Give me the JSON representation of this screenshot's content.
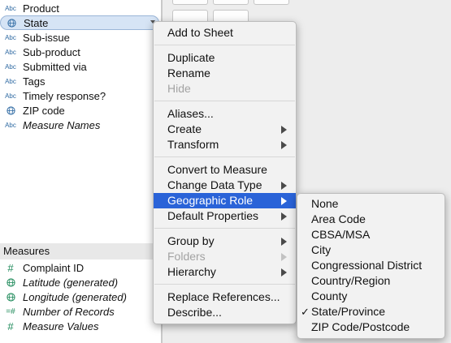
{
  "dimensions": {
    "items": [
      {
        "label": "Product",
        "icon": "abc-icon",
        "type": "abc",
        "italic": false
      },
      {
        "label": "State",
        "icon": "globe-icon",
        "type": "geo",
        "italic": false,
        "selected": true
      },
      {
        "label": "Sub-issue",
        "icon": "abc-icon",
        "type": "abc",
        "italic": false
      },
      {
        "label": "Sub-product",
        "icon": "abc-icon",
        "type": "abc",
        "italic": false
      },
      {
        "label": "Submitted via",
        "icon": "abc-icon",
        "type": "abc",
        "italic": false
      },
      {
        "label": "Tags",
        "icon": "abc-icon",
        "type": "abc",
        "italic": false
      },
      {
        "label": "Timely response?",
        "icon": "abc-icon",
        "type": "abc",
        "italic": false
      },
      {
        "label": "ZIP code",
        "icon": "globe-icon",
        "type": "geo",
        "italic": false
      },
      {
        "label": "Measure Names",
        "icon": "abc-icon",
        "type": "abc",
        "italic": true
      }
    ],
    "abc_text": "Abc"
  },
  "measures": {
    "header": "Measures",
    "items": [
      {
        "label": "Complaint ID",
        "icon": "hash-icon",
        "type": "num",
        "italic": false
      },
      {
        "label": "Latitude (generated)",
        "icon": "globe-icon",
        "type": "geo",
        "italic": true
      },
      {
        "label": "Longitude (generated)",
        "icon": "globe-icon",
        "type": "geo",
        "italic": true
      },
      {
        "label": "Number of Records",
        "icon": "hash-icon",
        "type": "calc",
        "italic": true
      },
      {
        "label": "Measure Values",
        "icon": "hash-icon",
        "type": "num",
        "italic": true
      }
    ],
    "hash_text": "#",
    "calc_text": "=#"
  },
  "context_menu": {
    "items": [
      {
        "label": "Add to Sheet",
        "submenu": false,
        "disabled": false
      },
      {
        "label": "Duplicate",
        "submenu": false,
        "disabled": false
      },
      {
        "label": "Rename",
        "submenu": false,
        "disabled": false
      },
      {
        "label": "Hide",
        "submenu": false,
        "disabled": true
      },
      {
        "label": "Aliases...",
        "submenu": false,
        "disabled": false
      },
      {
        "label": "Create",
        "submenu": true,
        "disabled": false
      },
      {
        "label": "Transform",
        "submenu": true,
        "disabled": false
      },
      {
        "label": "Convert to Measure",
        "submenu": false,
        "disabled": false
      },
      {
        "label": "Change Data Type",
        "submenu": true,
        "disabled": false
      },
      {
        "label": "Geographic Role",
        "submenu": true,
        "disabled": false,
        "highlighted": true
      },
      {
        "label": "Default Properties",
        "submenu": true,
        "disabled": false
      },
      {
        "label": "Group by",
        "submenu": true,
        "disabled": false
      },
      {
        "label": "Folders",
        "submenu": true,
        "disabled": true
      },
      {
        "label": "Hierarchy",
        "submenu": true,
        "disabled": false
      },
      {
        "label": "Replace References...",
        "submenu": false,
        "disabled": false
      },
      {
        "label": "Describe...",
        "submenu": false,
        "disabled": false
      }
    ]
  },
  "geographic_role_submenu": {
    "items": [
      {
        "label": "None",
        "checked": false
      },
      {
        "label": "Area Code",
        "checked": false
      },
      {
        "label": "CBSA/MSA",
        "checked": false
      },
      {
        "label": "City",
        "checked": false
      },
      {
        "label": "Congressional District",
        "checked": false
      },
      {
        "label": "Country/Region",
        "checked": false
      },
      {
        "label": "County",
        "checked": false
      },
      {
        "label": "State/Province",
        "checked": true
      },
      {
        "label": "ZIP Code/Postcode",
        "checked": false
      }
    ],
    "check_glyph": "✓"
  },
  "colors": {
    "highlight": "#2a63d8",
    "selected_pill": "#d6e4f5",
    "dimension_icon": "#2f6aa3",
    "measure_icon": "#1e8a5a"
  }
}
